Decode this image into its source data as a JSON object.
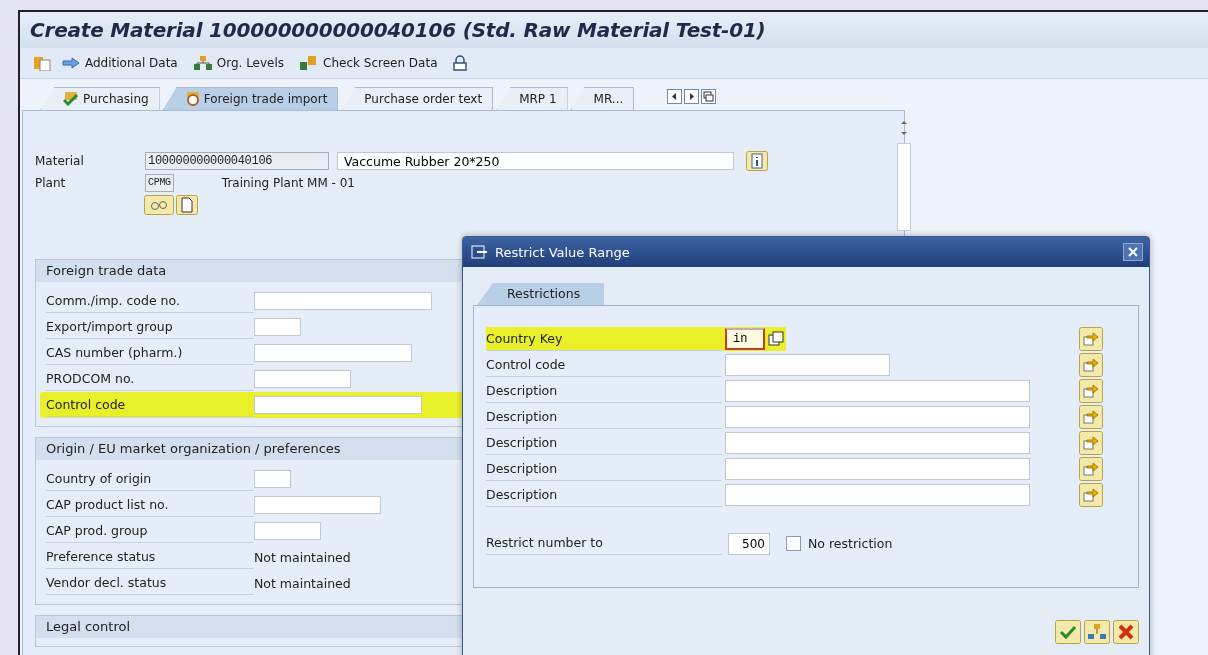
{
  "window": {
    "title": "Create Material 100000000000040106 (Std. Raw Material Test-01)"
  },
  "toolbar": [
    {
      "label": "Additional Data",
      "kind": "arrow"
    },
    {
      "label": "Org. Levels",
      "kind": "org"
    },
    {
      "label": "Check Screen Data",
      "kind": "check"
    }
  ],
  "tabs": [
    {
      "label": "Purchasing",
      "selected": false,
      "kind": "check"
    },
    {
      "label": "Foreign trade import",
      "selected": true,
      "kind": "globe"
    },
    {
      "label": "Purchase order text",
      "selected": false,
      "kind": "plain"
    },
    {
      "label": "MRP 1",
      "selected": false,
      "kind": "plain"
    },
    {
      "label": "MR...",
      "selected": false,
      "kind": "plain"
    }
  ],
  "header": [
    {
      "label": "Material",
      "value": "100000000000040106",
      "description": "Vaccume Rubber 20*250",
      "kind": "field"
    },
    {
      "label": "Plant",
      "value": "CPMG",
      "description": "Training Plant MM - 01",
      "kind": "text"
    }
  ],
  "sections": [
    {
      "title": "Foreign trade data",
      "rows": [
        {
          "label": "Comm./imp. code no.",
          "kind": "field",
          "highlighted": false
        },
        {
          "label": "Export/import group",
          "kind": "field",
          "highlighted": false
        },
        {
          "label": "CAS number (pharm.)",
          "kind": "field",
          "highlighted": false
        },
        {
          "label": "PRODCOM no.",
          "kind": "field",
          "highlighted": false
        },
        {
          "label": "Control code",
          "kind": "field",
          "highlighted": true
        }
      ]
    },
    {
      "title": "Origin / EU market organization / preferences",
      "rows": [
        {
          "label": "Country of origin",
          "kind": "field",
          "highlighted": false
        },
        {
          "label": "CAP product list no.",
          "kind": "field",
          "highlighted": false
        },
        {
          "label": "CAP prod. group",
          "kind": "field",
          "highlighted": false
        },
        {
          "label": "Preference status",
          "kind": "text",
          "value": "Not maintained",
          "highlighted": false
        },
        {
          "label": "Vendor decl. status",
          "kind": "text",
          "value": "Not maintained",
          "highlighted": false
        }
      ]
    },
    {
      "title": "Legal control"
    }
  ],
  "dialog": {
    "title": "Restrict Value Range",
    "tabs": [
      {
        "label": "Restrictions",
        "selected": true
      }
    ],
    "rows": [
      {
        "label": "Country Key",
        "value": "in",
        "highlighted": true
      },
      {
        "label": "Control code",
        "highlighted": false
      },
      {
        "label": "Description",
        "highlighted": false
      },
      {
        "label": "Description",
        "highlighted": false
      },
      {
        "label": "Description",
        "highlighted": false
      },
      {
        "label": "Description",
        "highlighted": false
      },
      {
        "label": "Description",
        "highlighted": false
      }
    ],
    "restrict": {
      "label": "Restrict number to",
      "value": "500"
    },
    "no_restriction": {
      "label": "No restriction",
      "checked": false
    }
  }
}
